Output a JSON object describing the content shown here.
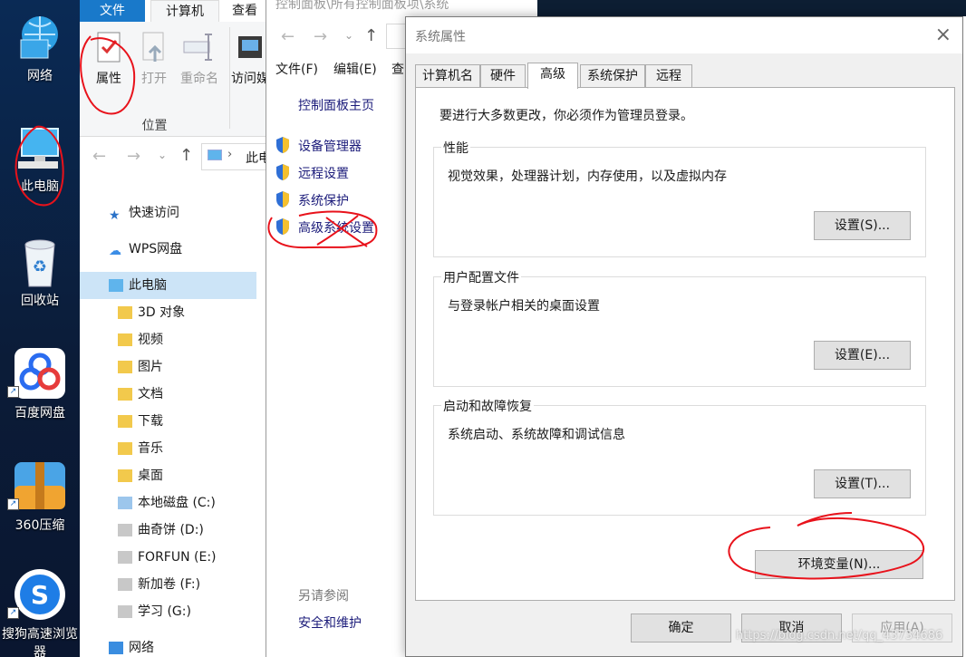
{
  "desktop": {
    "icons": [
      {
        "label": "网络",
        "icon": "network-icon"
      },
      {
        "label": "此电脑",
        "icon": "computer-icon"
      },
      {
        "label": "回收站",
        "icon": "recycle-bin-icon"
      },
      {
        "label": "百度网盘",
        "icon": "baidu-netdisk-icon"
      },
      {
        "label": "360压缩",
        "icon": "archive-icon"
      },
      {
        "label": "搜狗高速浏览器",
        "icon": "sogou-browser-icon"
      }
    ]
  },
  "explorer": {
    "ribbon_tabs": [
      "文件",
      "计算机",
      "查看"
    ],
    "ribbon_buttons": [
      {
        "label": "属性",
        "enabled": true
      },
      {
        "label": "打开",
        "enabled": false
      },
      {
        "label": "重命名",
        "enabled": false
      },
      {
        "label": "访问媒",
        "enabled": true
      }
    ],
    "group_label": "位置",
    "address": "此电",
    "nav_items": [
      {
        "label": "快速访问",
        "icon": "star-icon",
        "level": 0
      },
      {
        "label": "WPS网盘",
        "icon": "cloud-icon",
        "level": 0
      },
      {
        "label": "此电脑",
        "icon": "computer-icon",
        "level": 0,
        "selected": true
      },
      {
        "label": "3D 对象",
        "icon": "folder-3d-icon",
        "level": 1
      },
      {
        "label": "视频",
        "icon": "folder-video-icon",
        "level": 1
      },
      {
        "label": "图片",
        "icon": "folder-pictures-icon",
        "level": 1
      },
      {
        "label": "文档",
        "icon": "folder-documents-icon",
        "level": 1
      },
      {
        "label": "下载",
        "icon": "folder-downloads-icon",
        "level": 1
      },
      {
        "label": "音乐",
        "icon": "folder-music-icon",
        "level": 1
      },
      {
        "label": "桌面",
        "icon": "folder-desktop-icon",
        "level": 1
      },
      {
        "label": "本地磁盘 (C:)",
        "icon": "windows-drive-icon",
        "level": 1
      },
      {
        "label": "曲奇饼 (D:)",
        "icon": "drive-icon",
        "level": 1
      },
      {
        "label": "FORFUN (E:)",
        "icon": "drive-icon",
        "level": 1
      },
      {
        "label": "新加卷 (F:)",
        "icon": "drive-icon",
        "level": 1
      },
      {
        "label": "学习 (G:)",
        "icon": "drive-icon",
        "level": 1
      },
      {
        "label": "网络",
        "icon": "network-icon",
        "level": 0
      }
    ]
  },
  "control_panel": {
    "title": "控制面板\\所有控制面板项\\系统",
    "menu": [
      "文件(F)",
      "编辑(E)",
      "查"
    ],
    "home_link": "控制面板主页",
    "links": [
      "设备管理器",
      "远程设置",
      "系统保护",
      "高级系统设置"
    ],
    "see_also": "另请参阅",
    "security_link": "安全和维护"
  },
  "dialog": {
    "title": "系统属性",
    "tabs": [
      "计算机名",
      "硬件",
      "高级",
      "系统保护",
      "远程"
    ],
    "active_tab": "高级",
    "admin_note": "要进行大多数更改，你必须作为管理员登录。",
    "groups": [
      {
        "legend": "性能",
        "description": "视觉效果，处理器计划，内存使用，以及虚拟内存",
        "button": "设置(S)..."
      },
      {
        "legend": "用户配置文件",
        "description": "与登录帐户相关的桌面设置",
        "button": "设置(E)..."
      },
      {
        "legend": "启动和故障恢复",
        "description": "系统启动、系统故障和调试信息",
        "button": "设置(T)..."
      }
    ],
    "env_button": "环境变量(N)...",
    "ok": "确定",
    "cancel": "取消",
    "apply": "应用(A)"
  },
  "watermark": "https://blog.csdn.net/qq_43734686",
  "colors": {
    "accent": "#1979ca",
    "annotation": "#e8121b",
    "selection": "#cce4f7"
  }
}
